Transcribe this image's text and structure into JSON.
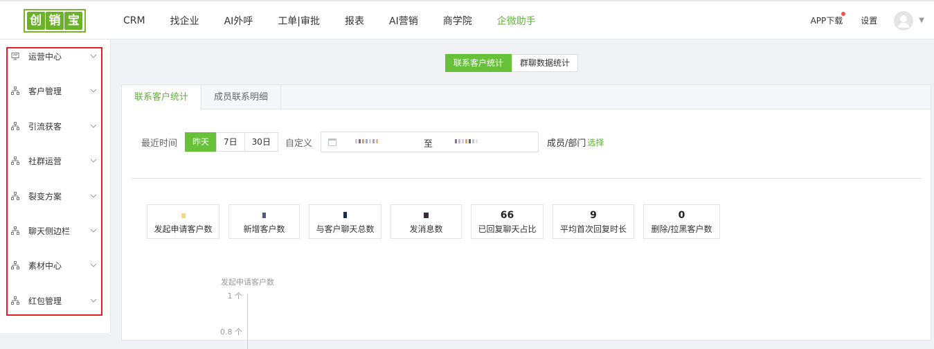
{
  "topbar": {
    "logo_chars": [
      "创",
      "销",
      "宝"
    ],
    "nav": [
      "CRM",
      "找企业",
      "AI外呼",
      "工单|审批",
      "报表",
      "AI营销",
      "商学院",
      "企微助手"
    ],
    "active_nav": "企微助手",
    "app_download": "APP下载",
    "settings": "设置"
  },
  "sidebar": {
    "items": [
      {
        "label": "运营中心",
        "icon": "monitor-icon"
      },
      {
        "label": "客户管理",
        "icon": "sitemap-icon"
      },
      {
        "label": "引流获客",
        "icon": "sitemap-icon"
      },
      {
        "label": "社群运营",
        "icon": "sitemap-icon"
      },
      {
        "label": "裂变方案",
        "icon": "sitemap-icon"
      },
      {
        "label": "聊天侧边栏",
        "icon": "sitemap-icon"
      },
      {
        "label": "素材中心",
        "icon": "sitemap-icon"
      },
      {
        "label": "红包管理",
        "icon": "sitemap-icon"
      }
    ]
  },
  "segment": {
    "contact_stats": "联系客户统计",
    "group_stats": "群聊数据统计",
    "selected": "联系客户统计"
  },
  "tabs": {
    "contact_stats": "联系客户统计",
    "member_detail": "成员联系明细",
    "selected": "联系客户统计"
  },
  "filter": {
    "recent_label": "最近时间",
    "yesterday": "昨天",
    "days7": "7日",
    "days30": "30日",
    "selected": "昨天",
    "custom_label": "自定义",
    "date_separator": "至",
    "member_label": "成员/部门",
    "select_link": "选择"
  },
  "stats": [
    {
      "label": "发起申请客户数",
      "value": ""
    },
    {
      "label": "新增客户数",
      "value": ""
    },
    {
      "label": "与客户聊天总数",
      "value": ""
    },
    {
      "label": "发消息数",
      "value": ""
    },
    {
      "label": "已回复聊天占比",
      "value": "66"
    },
    {
      "label": "平均首次回复时长",
      "value": "9"
    },
    {
      "label": "删除/拉黑客户数",
      "value": "0"
    }
  ],
  "chart_data": {
    "type": "line",
    "title": "发起申请客户数",
    "y_ticks": [
      "1 个",
      "0.8 个"
    ]
  },
  "colors": {
    "accent": "#67c23a",
    "sidebar_highlight_border": "#e02020"
  }
}
